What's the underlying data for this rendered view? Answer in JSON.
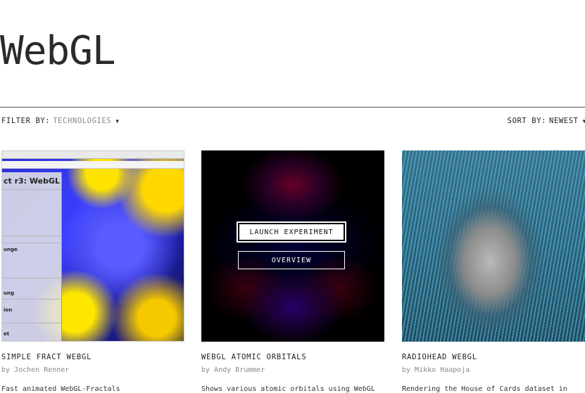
{
  "page": {
    "title": "WebGL"
  },
  "filter": {
    "label": "FILTER BY:",
    "value": "TECHNOLOGIES"
  },
  "sort": {
    "label": "SORT BY:",
    "value": "NEWEST"
  },
  "cards": [
    {
      "title": "SIMPLE FRACT WEBGL",
      "author": "by Jochen Renner",
      "description": "Fast animated WebGL-Fractals",
      "thumb": {
        "panel_heading": "ct r3: WebGL",
        "section_1": "unge",
        "section_2": "ung",
        "section_3": "ion",
        "section_4": "et"
      }
    },
    {
      "title": "WEBGL ATOMIC ORBITALS",
      "author": "by Andy Brummer",
      "description": "Shows various atomic orbitals using WebGL",
      "launch_label": "LAUNCH EXPERIMENT",
      "overview_label": "OVERVIEW"
    },
    {
      "title": "RADIOHEAD WEBGL",
      "author": "by Mikko Haapoja",
      "description": "Rendering the House of Cards dataset in"
    }
  ]
}
